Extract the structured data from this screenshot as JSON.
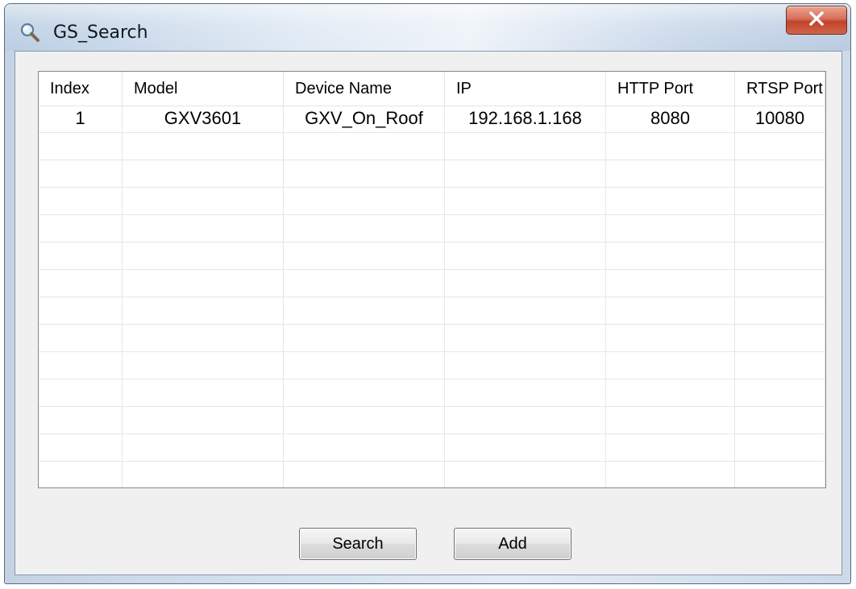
{
  "window": {
    "title": "GS_Search",
    "title_icon": "magnifier-icon",
    "close_icon": "close-icon"
  },
  "device_list": {
    "columns": [
      "Index",
      "Model",
      "Device Name",
      "IP",
      "HTTP Port",
      "RTSP Port"
    ],
    "rows": [
      [
        "1",
        "GXV3601",
        "GXV_On_Roof",
        "192.168.1.168",
        "8080",
        "10080"
      ]
    ]
  },
  "buttons": {
    "search_label": "Search",
    "add_label": "Add"
  },
  "colors": {
    "close_button": "#c2422a",
    "client_background": "#f0f0f0"
  }
}
